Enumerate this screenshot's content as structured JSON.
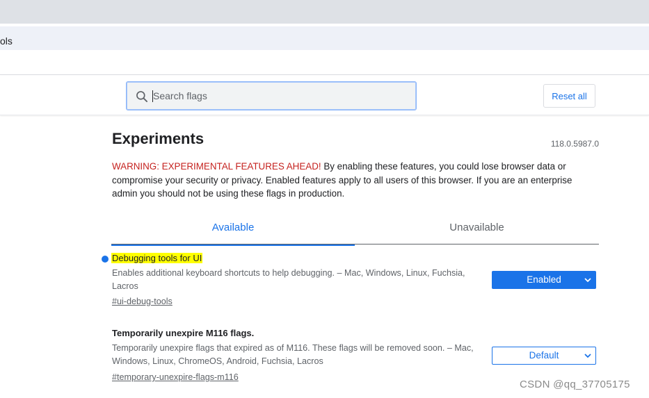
{
  "browser": {
    "omnibox_text": "ols"
  },
  "header": {
    "search": {
      "placeholder": "Search flags",
      "value": ""
    },
    "reset_label": "Reset all"
  },
  "main": {
    "title": "Experiments",
    "version": "118.0.5987.0",
    "warning_red": "WARNING: EXPERIMENTAL FEATURES AHEAD!",
    "warning_text": " By enabling these features, you could lose browser data or compromise your security or privacy. Enabled features apply to all users of this browser. If you are an enterprise admin you should not be using these flags in production.",
    "tabs": [
      {
        "label": "Available",
        "active": true
      },
      {
        "label": "Unavailable",
        "active": false
      }
    ],
    "flags": [
      {
        "title": "Debugging tools for UI",
        "description": "Enables additional keyboard shortcuts to help debugging. – Mac, Windows, Linux, Fuchsia, Lacros",
        "link": "#ui-debug-tools",
        "value": "Enabled",
        "modified": true
      },
      {
        "title": "Temporarily unexpire M116 flags.",
        "description": "Temporarily unexpire flags that expired as of M116. These flags will be removed soon. – Mac, Windows, Linux, ChromeOS, Android, Fuchsia, Lacros",
        "link": "#temporary-unexpire-flags-m116",
        "value": "Default",
        "modified": false
      }
    ]
  },
  "watermark": "CSDN @qq_37705175",
  "colors": {
    "accent": "#1a73e8",
    "warning": "#c5221f",
    "highlight": "#ffff00"
  }
}
